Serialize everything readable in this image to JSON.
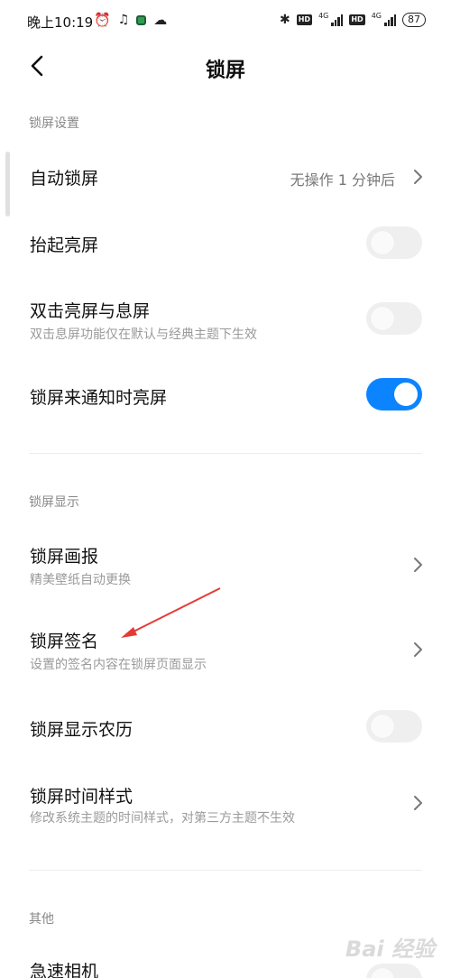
{
  "status_bar": {
    "time": "晚上10:19",
    "battery": "87",
    "left_icons": [
      "alarm-icon",
      "music-app-icon",
      "app-notification-icon",
      "cloud-icon"
    ],
    "right_icons": [
      "bluetooth-icon",
      "hd-icon",
      "signal-4g-icon",
      "hd-icon",
      "signal-4g-icon"
    ],
    "net_label_1": "4G",
    "net_label_2": "4G",
    "hd_label": "HD"
  },
  "header": {
    "title": "锁屏",
    "back_icon": "back-arrow-icon"
  },
  "sections": {
    "lock_settings": {
      "header": "锁屏设置",
      "auto_lock": {
        "title": "自动锁屏",
        "value": "无操作 1 分钟后"
      },
      "raise_to_wake": {
        "title": "抬起亮屏",
        "enabled": false
      },
      "double_tap": {
        "title": "双击亮屏与息屏",
        "subtitle": "双击息屏功能仅在默认与经典主题下生效",
        "enabled": false
      },
      "notification_wake": {
        "title": "锁屏来通知时亮屏",
        "enabled": true
      }
    },
    "lock_display": {
      "header": "锁屏显示",
      "wallpaper": {
        "title": "锁屏画报",
        "subtitle": "精美壁纸自动更换"
      },
      "signature": {
        "title": "锁屏签名",
        "subtitle": "设置的签名内容在锁屏页面显示"
      },
      "lunar": {
        "title": "锁屏显示农历",
        "enabled": false
      },
      "clock_style": {
        "title": "锁屏时间样式",
        "subtitle": "修改系统主题的时间样式，对第三方主题不生效"
      }
    },
    "other": {
      "header": "其他",
      "quick_camera": {
        "title": "急速相机"
      }
    }
  },
  "colors": {
    "accent": "#0d84ff",
    "annotation_arrow": "#e53935"
  },
  "watermark": "Bai 经验"
}
